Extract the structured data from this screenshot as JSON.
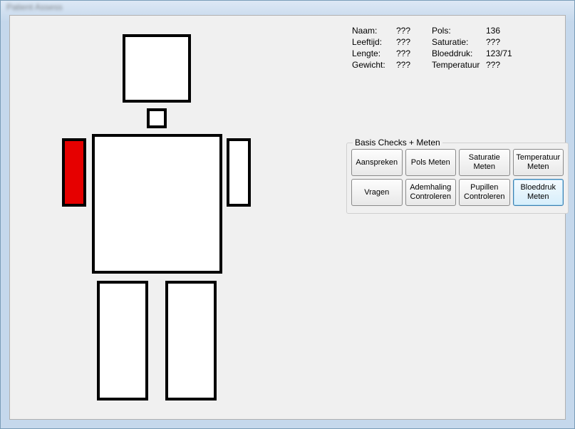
{
  "window": {
    "title": "Patient Assess"
  },
  "patient": {
    "labels": {
      "naam": "Naam:",
      "leeftijd": "Leeftijd:",
      "lengte": "Lengte:",
      "gewicht": "Gewicht:",
      "pols": "Pols:",
      "saturatie": "Saturatie:",
      "bloeddruk": "Bloeddruk:",
      "temperatuur": "Temperatuur"
    },
    "values": {
      "naam": "???",
      "leeftijd": "???",
      "lengte": "???",
      "gewicht": "???",
      "pols": "136",
      "saturatie": "???",
      "bloeddruk": "123/71",
      "temperatuur": "???"
    }
  },
  "groupTitle": "Basis Checks + Meten",
  "buttons": {
    "aanspreken": "Aanspreken",
    "polsMeten": "Pols Meten",
    "saturatieMeten": "Saturatie Meten",
    "temperatuurMeten": "Temperatuur Meten",
    "vragen": "Vragen",
    "ademhalingControleren": "Ademhaling Controleren",
    "pupillenControleren": "Pupillen Controleren",
    "bloeddrukMeten": "Bloeddruk Meten"
  },
  "body": {
    "injured": [
      "left-upper-arm"
    ]
  }
}
